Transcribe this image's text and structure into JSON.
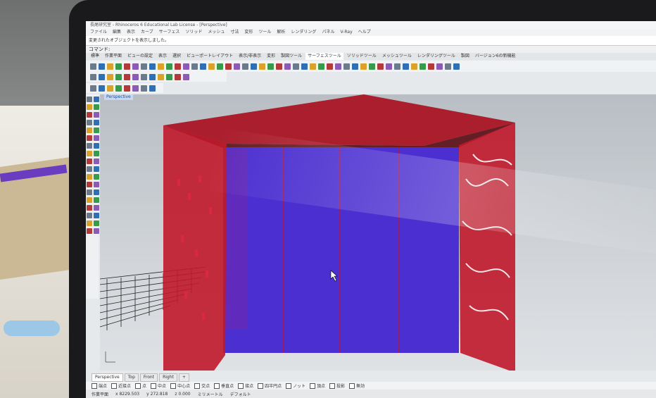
{
  "window": {
    "title": "長尾研究室 - Rhinoceros 6 Educational Lab License - [Perspective]"
  },
  "menu": [
    "ファイル",
    "編集",
    "表示",
    "カーブ",
    "サーフェス",
    "ソリッド",
    "メッシュ",
    "寸法",
    "変形",
    "ツール",
    "解析",
    "レンダリング",
    "パネル",
    "V-Ray",
    "ヘルプ"
  ],
  "command": {
    "history": "変更されたオブジェクトを表示しました。",
    "label": "コマンド:"
  },
  "tabs": [
    {
      "label": "標準",
      "active": false
    },
    {
      "label": "作業平面",
      "active": false
    },
    {
      "label": "ビューの設定",
      "active": false
    },
    {
      "label": "表示",
      "active": false
    },
    {
      "label": "選択",
      "active": false
    },
    {
      "label": "ビューポートレイアウト",
      "active": false
    },
    {
      "label": "表示/非表示",
      "active": false
    },
    {
      "label": "変形",
      "active": false
    },
    {
      "label": "製図ツール",
      "active": false
    },
    {
      "label": "サーフェスツール",
      "active": true
    },
    {
      "label": "ソリッドツール",
      "active": false
    },
    {
      "label": "メッシュツール",
      "active": false
    },
    {
      "label": "レンダリングツール",
      "active": false
    },
    {
      "label": "製図",
      "active": false
    },
    {
      "label": "バージョン6の新機能",
      "active": false
    }
  ],
  "viewport": {
    "name": "Perspective"
  },
  "view_tabs": [
    {
      "label": "Perspective",
      "active": true
    },
    {
      "label": "Top",
      "active": false
    },
    {
      "label": "Front",
      "active": false
    },
    {
      "label": "Right",
      "active": false
    },
    {
      "label": "+",
      "active": false
    }
  ],
  "osnaps": [
    "端点",
    "近接点",
    "点",
    "中点",
    "中心点",
    "交点",
    "垂直点",
    "接点",
    "四半円点",
    "ノット",
    "頂点",
    "投影",
    "無効"
  ],
  "status": {
    "cplane": "作業平面",
    "x": "x 8229.503",
    "y": "y 272.818",
    "z": "z 0.000",
    "units": "ミリメートル",
    "layer": "デフォルト"
  },
  "colors": {
    "frame_red": "#c0182a",
    "frame_red_dark": "#7d0f1a",
    "panel_blue": "#4b2fd0",
    "panel_blue_dark": "#3a24a6",
    "viewport_bg": "#c9cdd1"
  }
}
